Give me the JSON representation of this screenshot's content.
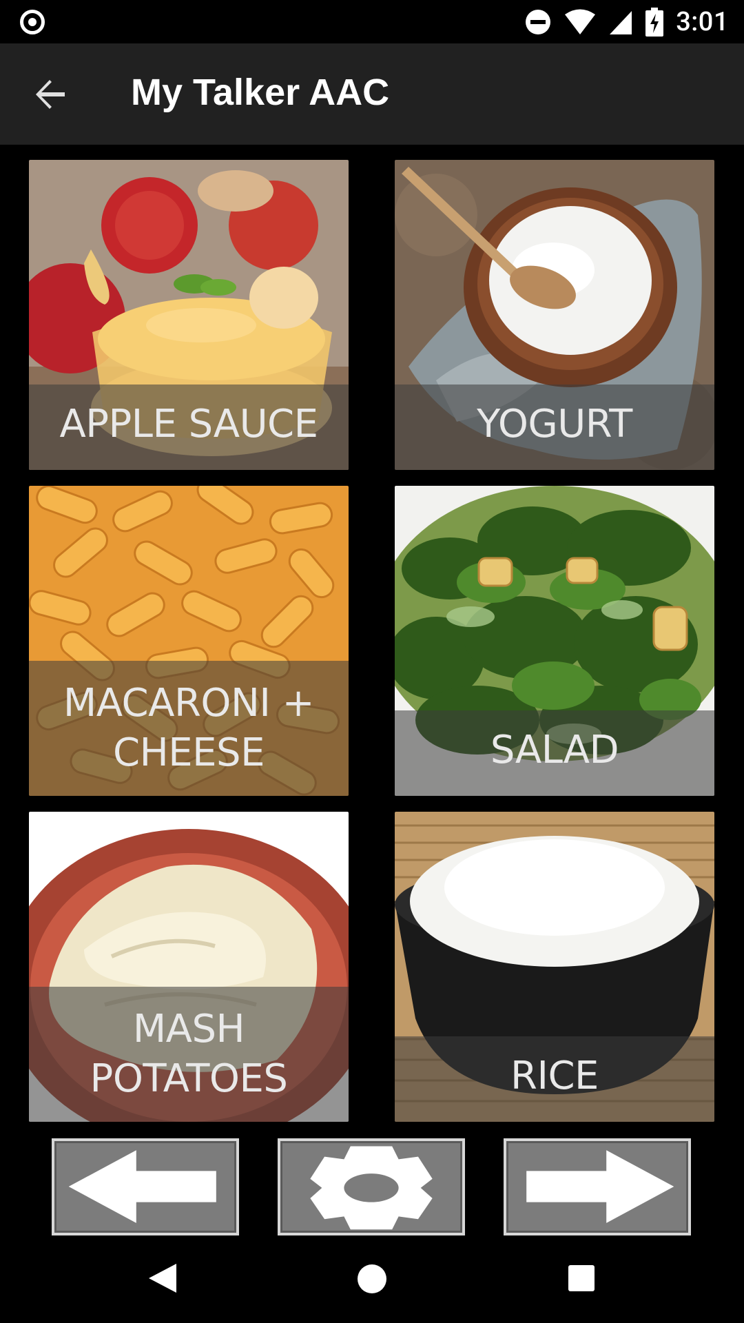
{
  "status_bar": {
    "time": "3:01",
    "icons": [
      "record-icon",
      "do-not-disturb-icon",
      "wifi-icon",
      "signal-icon",
      "battery-charging-icon"
    ]
  },
  "app_bar": {
    "title": "My Talker AAC",
    "back_icon": "back-arrow-icon"
  },
  "tiles": [
    {
      "label": "APPLE SAUCE",
      "image": "apple-sauce-photo"
    },
    {
      "label": "YOGURT",
      "image": "yogurt-photo"
    },
    {
      "label_line1": "MACARONI +",
      "label_line2": "CHEESE",
      "image": "macaroni-cheese-photo"
    },
    {
      "label": "SALAD",
      "image": "salad-photo"
    },
    {
      "label_line1": "MASH",
      "label_line2": "POTATOES",
      "image": "mash-potatoes-photo"
    },
    {
      "label": "RICE",
      "image": "rice-photo"
    }
  ],
  "bottom_controls": [
    "previous-page-arrow-icon",
    "settings-gear-icon",
    "next-page-arrow-icon"
  ],
  "system_nav": [
    "back-triangle-icon",
    "home-circle-icon",
    "recents-square-icon"
  ],
  "colors": {
    "app_bar": "#212121",
    "background": "#000000",
    "tile_overlay": "rgba(60,60,60,0.55)",
    "nav_button": "#7c7c7c"
  }
}
